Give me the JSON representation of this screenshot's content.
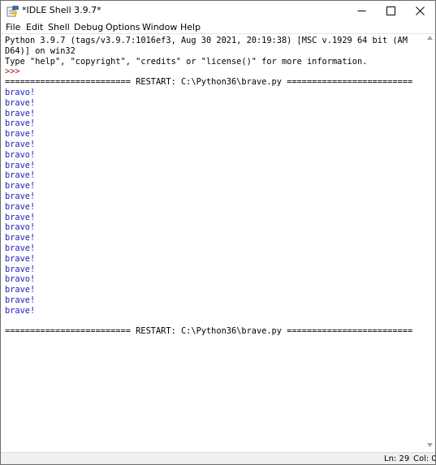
{
  "window": {
    "title": "*IDLE Shell 3.9.7*",
    "icon": "idle-python-icon"
  },
  "menu": {
    "file": "File",
    "edit": "Edit",
    "shell": "Shell",
    "debug": "Debug",
    "options": "Options",
    "window": "Window",
    "help": "Help"
  },
  "shell": {
    "lines": [
      {
        "text": "Python 3.9.7 (tags/v3.9.7:1016ef3, Aug 30 2021, 20:19:38) [MSC v.1929 64 bit (AM",
        "kind": "out"
      },
      {
        "text": "D64)] on win32",
        "kind": "out"
      },
      {
        "text": "Type \"help\", \"copyright\", \"credits\" or \"license()\" for more information.",
        "kind": "out"
      },
      {
        "text": ">>> ",
        "kind": "prompt"
      },
      {
        "text": "========================= RESTART: C:\\Python36\\brave.py =========================",
        "kind": "out"
      },
      {
        "text": "bravo!",
        "kind": "stdout"
      },
      {
        "text": "brave!",
        "kind": "stdout"
      },
      {
        "text": "brave!",
        "kind": "stdout"
      },
      {
        "text": "brave!",
        "kind": "stdout"
      },
      {
        "text": "brave!",
        "kind": "stdout"
      },
      {
        "text": "brave!",
        "kind": "stdout"
      },
      {
        "text": "bravo!",
        "kind": "stdout"
      },
      {
        "text": "brave!",
        "kind": "stdout"
      },
      {
        "text": "brave!",
        "kind": "stdout"
      },
      {
        "text": "brave!",
        "kind": "stdout"
      },
      {
        "text": "brave!",
        "kind": "stdout"
      },
      {
        "text": "brave!",
        "kind": "stdout"
      },
      {
        "text": "brave!",
        "kind": "stdout"
      },
      {
        "text": "bravo!",
        "kind": "stdout"
      },
      {
        "text": "brave!",
        "kind": "stdout"
      },
      {
        "text": "brave!",
        "kind": "stdout"
      },
      {
        "text": "brave!",
        "kind": "stdout"
      },
      {
        "text": "brave!",
        "kind": "stdout"
      },
      {
        "text": "bravo!",
        "kind": "stdout"
      },
      {
        "text": "brave!",
        "kind": "stdout"
      },
      {
        "text": "brave!",
        "kind": "stdout"
      },
      {
        "text": "brave!",
        "kind": "stdout"
      },
      {
        "text": "",
        "kind": "out"
      },
      {
        "text": "========================= RESTART: C:\\Python36\\brave.py =========================",
        "kind": "out"
      }
    ]
  },
  "status": {
    "line": "Ln: 29",
    "column": "Col: 0"
  },
  "colors": {
    "stdout": "#1f1fb8",
    "prompt": "#a31515",
    "text": "#000000"
  }
}
